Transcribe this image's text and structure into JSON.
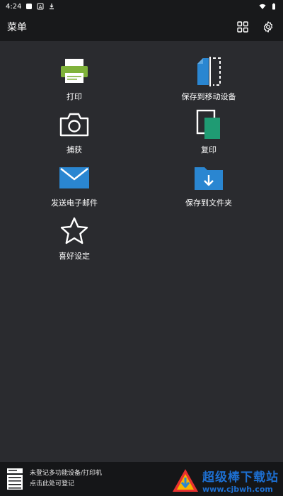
{
  "status_bar": {
    "time": "4:24",
    "icons": [
      "notification-icon",
      "font-icon",
      "download-icon",
      "wifi-icon",
      "battery-icon"
    ]
  },
  "app_bar": {
    "title": "菜单",
    "actions": [
      "grid-icon",
      "gear-icon"
    ]
  },
  "menu": {
    "items": [
      {
        "label": "打印",
        "icon": "printer-icon"
      },
      {
        "label": "保存到移动设备",
        "icon": "save-mobile-icon"
      },
      {
        "label": "捕获",
        "icon": "camera-icon"
      },
      {
        "label": "复印",
        "icon": "copy-icon"
      },
      {
        "label": "发送电子邮件",
        "icon": "email-icon"
      },
      {
        "label": "保存到文件夹",
        "icon": "folder-download-icon"
      },
      {
        "label": "喜好设定",
        "icon": "star-icon"
      }
    ]
  },
  "bottom_bar": {
    "line1": "未登记多功能设备/打印机",
    "line2": "点击此处可登记"
  },
  "watermark": {
    "title": "超级棒下载站",
    "url": "www.cjbwh.com"
  },
  "colors": {
    "background": "#2a2b2f",
    "bar": "#18191b",
    "printer_green": "#7fb23a",
    "accent_blue": "#2a86d1",
    "copy_green": "#1f9b73"
  }
}
